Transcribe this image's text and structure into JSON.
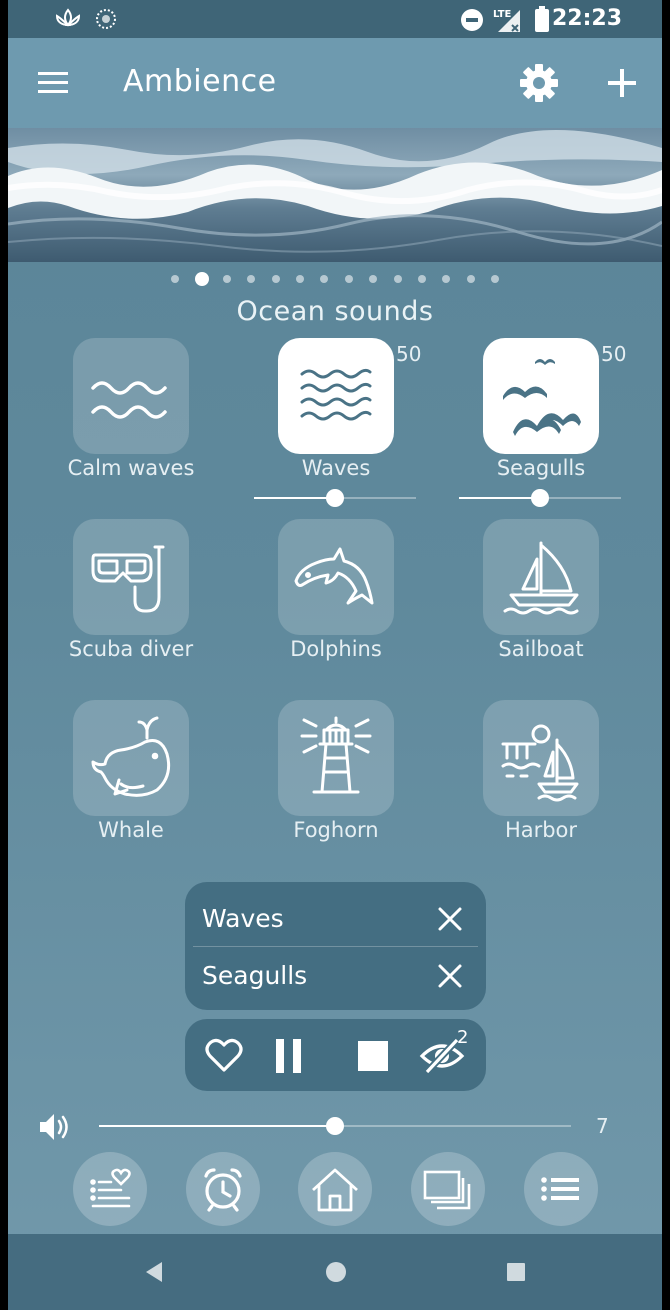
{
  "status_bar": {
    "time": "22:23",
    "network": "LTE"
  },
  "toolbar": {
    "title": "Ambience"
  },
  "pager": {
    "page_count": 14,
    "active_index": 1
  },
  "section_title": "Ocean sounds",
  "sounds": [
    {
      "label": "Calm waves",
      "icon": "calm-waves-icon",
      "active": false
    },
    {
      "label": "Waves",
      "icon": "waves-icon",
      "active": true,
      "volume": "50"
    },
    {
      "label": "Seagulls",
      "icon": "seagulls-icon",
      "active": true,
      "volume": "50"
    },
    {
      "label": "Scuba diver",
      "icon": "scuba-mask-icon",
      "active": false
    },
    {
      "label": "Dolphins",
      "icon": "dolphin-icon",
      "active": false
    },
    {
      "label": "Sailboat",
      "icon": "sailboat-icon",
      "active": false
    },
    {
      "label": "Whale",
      "icon": "whale-icon",
      "active": false
    },
    {
      "label": "Foghorn",
      "icon": "lighthouse-icon",
      "active": false
    },
    {
      "label": "Harbor",
      "icon": "harbor-icon",
      "active": false
    }
  ],
  "sound_sliders": {
    "waves": 0.5,
    "seagulls": 0.5
  },
  "playing": [
    {
      "name": "Waves"
    },
    {
      "name": "Seagulls"
    }
  ],
  "controls": {
    "hidden_count": "2"
  },
  "master_volume": {
    "value": "7",
    "fraction": 0.5
  },
  "bottom_nav": [
    "favorites-icon",
    "alarm-clock-icon",
    "home-icon",
    "layers-icon",
    "list-icon"
  ],
  "colors": {
    "background": "#5f899c",
    "toolbar": "#6e9aaf",
    "panel": "#446e82",
    "status_bar": "#3f6577"
  }
}
